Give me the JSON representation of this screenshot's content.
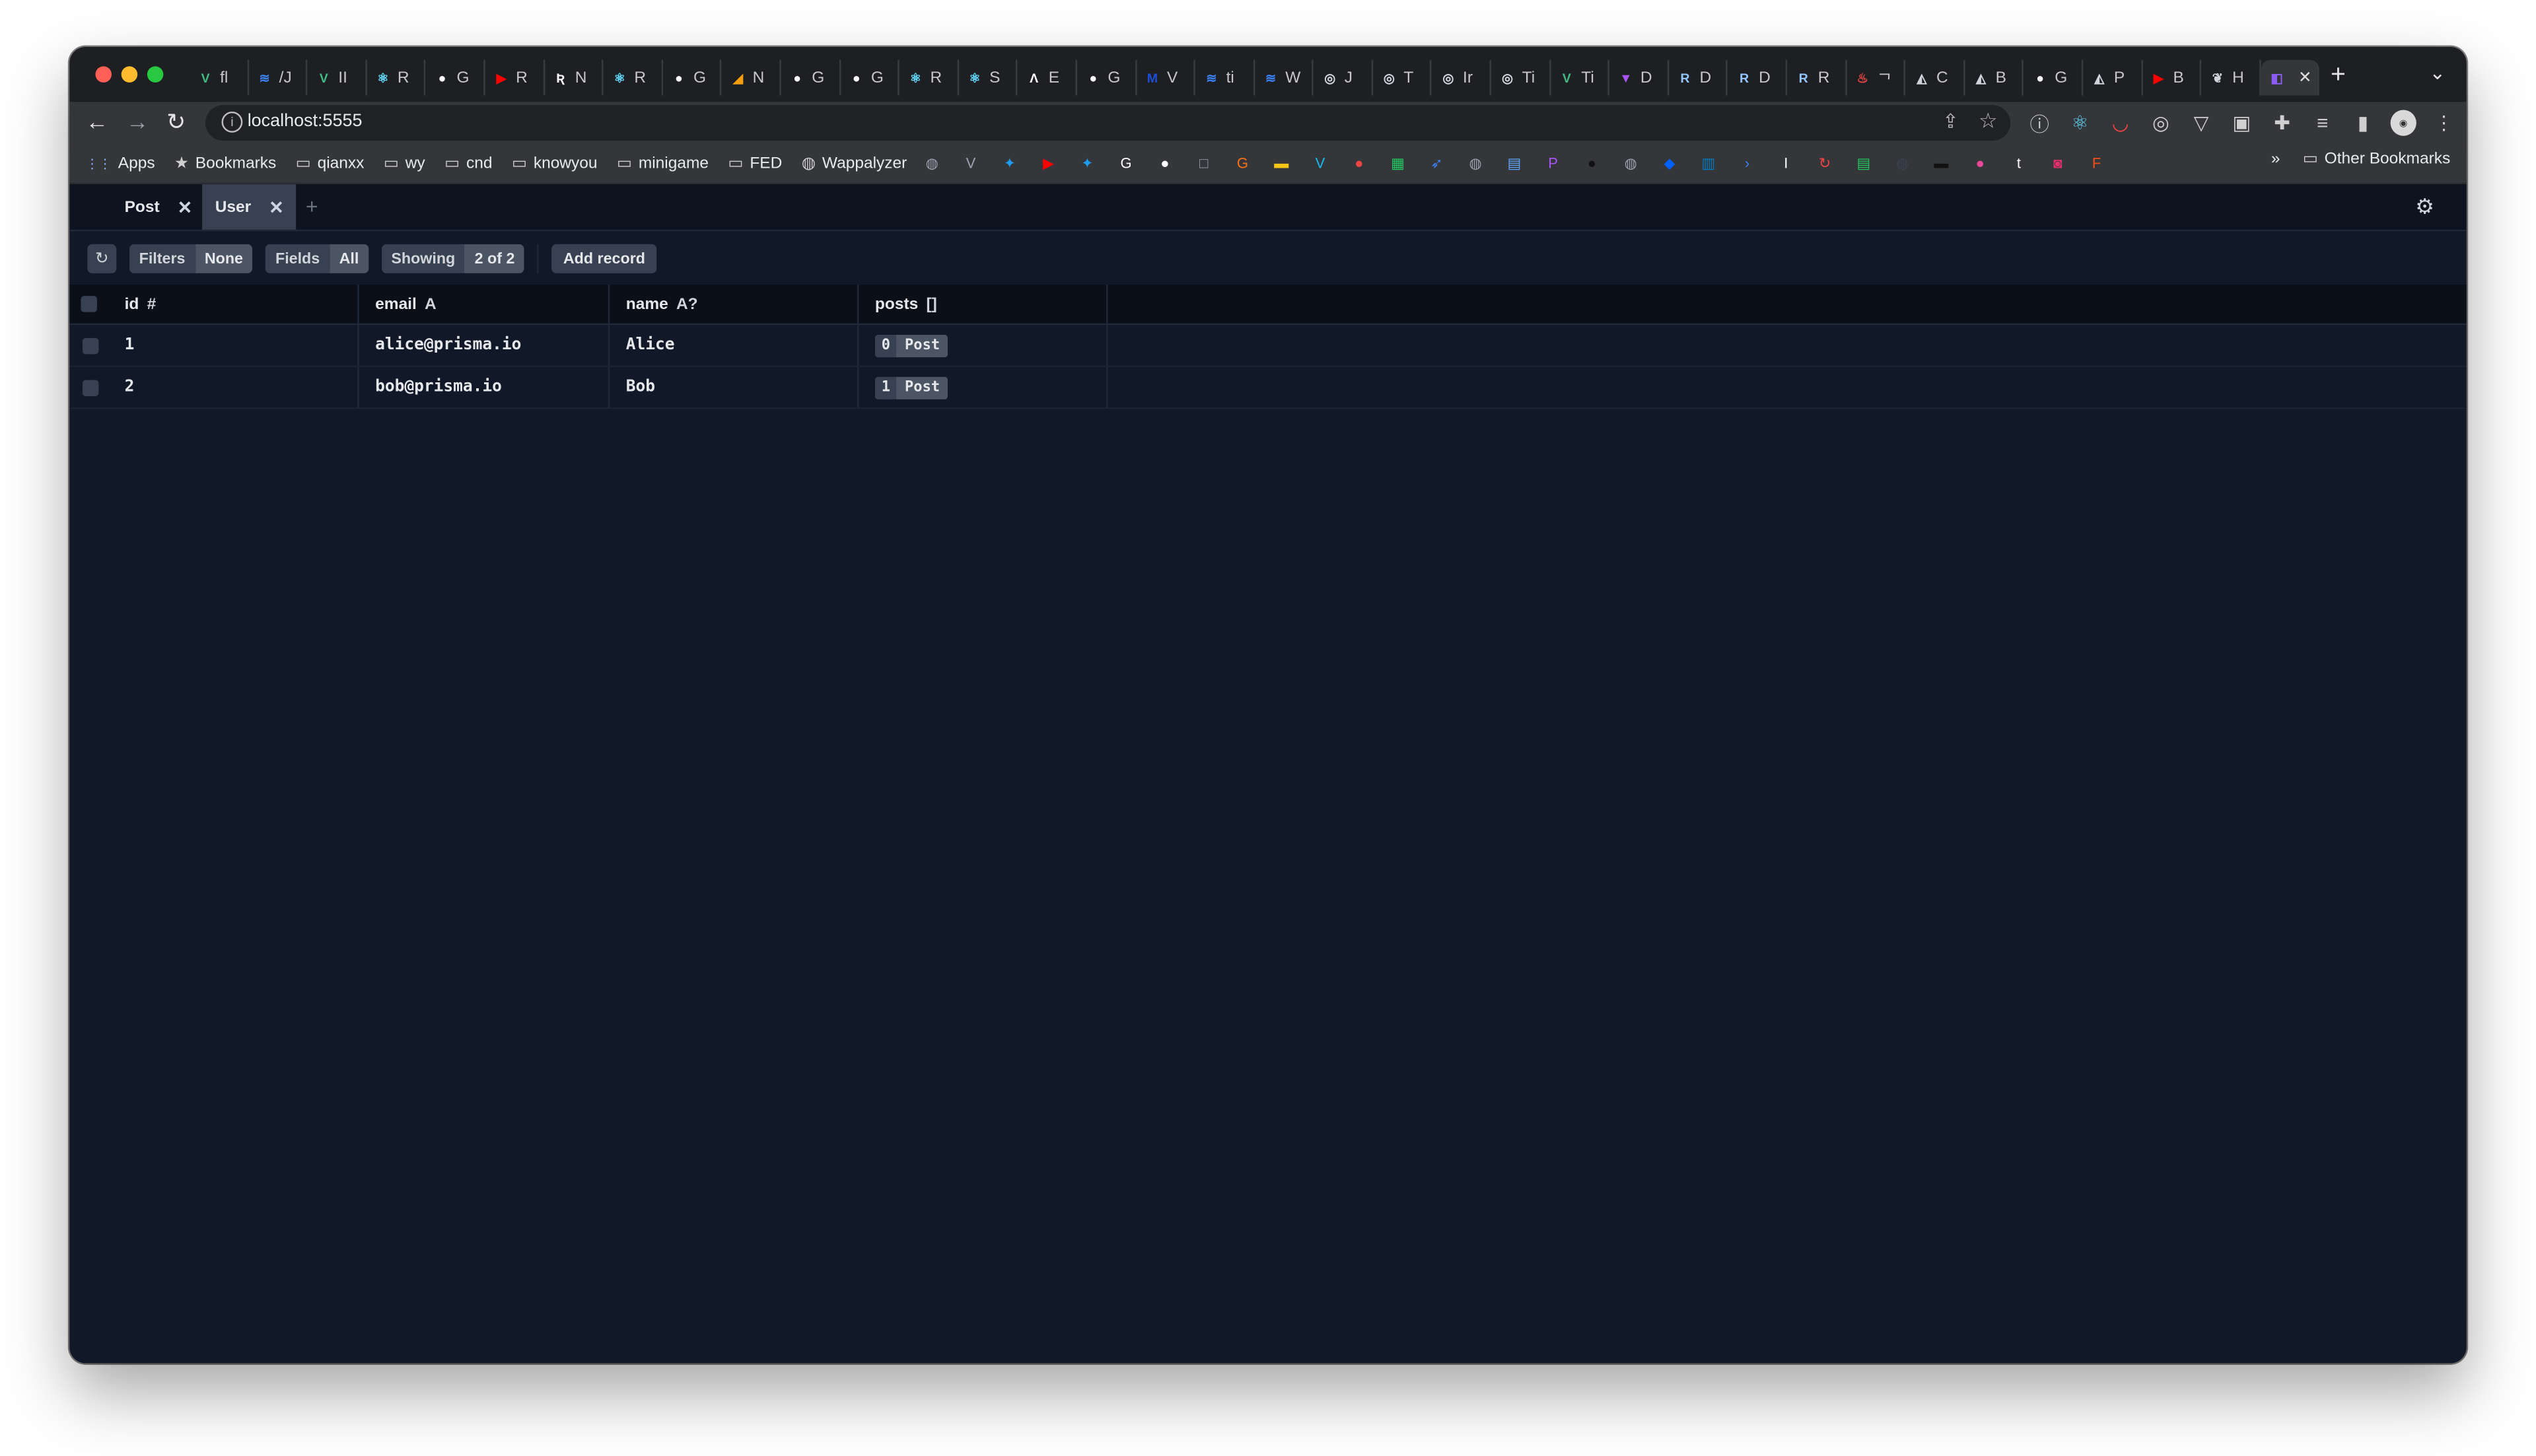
{
  "browser": {
    "tabs": [
      {
        "icon": "vue-icon",
        "color": "#42b883",
        "glyph": "V",
        "label": "fl"
      },
      {
        "icon": "stack-icon",
        "color": "#3b82f6",
        "glyph": "≋",
        "label": "/J"
      },
      {
        "icon": "vue-icon",
        "color": "#42b883",
        "glyph": "V",
        "label": "II"
      },
      {
        "icon": "react-icon",
        "color": "#61dafb",
        "glyph": "⚛",
        "label": "R"
      },
      {
        "icon": "github-icon",
        "color": "#ffffff",
        "glyph": "●",
        "label": "G"
      },
      {
        "icon": "youtube-icon",
        "color": "#ff0000",
        "glyph": "▶",
        "label": "R"
      },
      {
        "icon": "r-icon",
        "color": "#ffffff",
        "glyph": "Ʀ",
        "label": "N"
      },
      {
        "icon": "react-icon",
        "color": "#61dafb",
        "glyph": "⚛",
        "label": "R"
      },
      {
        "icon": "github-icon",
        "color": "#ffffff",
        "glyph": "●",
        "label": "G"
      },
      {
        "icon": "pizza-icon",
        "color": "#f59e0b",
        "glyph": "◢",
        "label": "N"
      },
      {
        "icon": "github-icon",
        "color": "#ffffff",
        "glyph": "●",
        "label": "G"
      },
      {
        "icon": "github-icon",
        "color": "#ffffff",
        "glyph": "●",
        "label": "G"
      },
      {
        "icon": "react-icon",
        "color": "#61dafb",
        "glyph": "⚛",
        "label": "R"
      },
      {
        "icon": "react-icon",
        "color": "#61dafb",
        "glyph": "⚛",
        "label": "S"
      },
      {
        "icon": "caret-icon",
        "color": "#ffffff",
        "glyph": "Λ",
        "label": "E"
      },
      {
        "icon": "github-icon",
        "color": "#ffffff",
        "glyph": "●",
        "label": "G"
      },
      {
        "icon": "m-icon",
        "color": "#1d4ed8",
        "glyph": "M",
        "label": "V"
      },
      {
        "icon": "stack-icon",
        "color": "#3b82f6",
        "glyph": "≋",
        "label": "ti"
      },
      {
        "icon": "stack-icon",
        "color": "#3b82f6",
        "glyph": "≋",
        "label": "W"
      },
      {
        "icon": "openai-icon",
        "color": "#d1d5db",
        "glyph": "◎",
        "label": "J"
      },
      {
        "icon": "openai-icon",
        "color": "#d1d5db",
        "glyph": "◎",
        "label": "T"
      },
      {
        "icon": "openai-icon",
        "color": "#d1d5db",
        "glyph": "◎",
        "label": "Ir"
      },
      {
        "icon": "openai-icon",
        "color": "#d1d5db",
        "glyph": "◎",
        "label": "Ti"
      },
      {
        "icon": "vue-icon",
        "color": "#42b883",
        "glyph": "V",
        "label": "Ti"
      },
      {
        "icon": "vite-icon",
        "color": "#a855f7",
        "glyph": "▼",
        "label": "D"
      },
      {
        "icon": "r-icon",
        "color": "#93c5fd",
        "glyph": "R",
        "label": "D"
      },
      {
        "icon": "r-icon",
        "color": "#93c5fd",
        "glyph": "R",
        "label": "D"
      },
      {
        "icon": "r-icon",
        "color": "#93c5fd",
        "glyph": "R",
        "label": "R"
      },
      {
        "icon": "fire-icon",
        "color": "#ef4444",
        "glyph": "♨",
        "label": "ᄀ"
      },
      {
        "icon": "prisma-icon",
        "color": "#d1d5db",
        "glyph": "◭",
        "label": "C"
      },
      {
        "icon": "prisma-icon",
        "color": "#d1d5db",
        "glyph": "◭",
        "label": "B"
      },
      {
        "icon": "github-icon",
        "color": "#ffffff",
        "glyph": "●",
        "label": "G"
      },
      {
        "icon": "prisma-icon",
        "color": "#d1d5db",
        "glyph": "◭",
        "label": "P"
      },
      {
        "icon": "youtube-icon",
        "color": "#ff0000",
        "glyph": "▶",
        "label": "B"
      },
      {
        "icon": "bird-icon",
        "color": "#d1d5db",
        "glyph": "❦",
        "label": "H"
      },
      {
        "icon": "studio-icon",
        "color": "#8b5cf6",
        "glyph": "◧",
        "label": ""
      }
    ],
    "active_tab_index": 35,
    "new_tab_label": "+",
    "tab_search_label": "⌄",
    "address": "localhost:5555",
    "bookmarks": [
      {
        "icon": "apps-icon",
        "label": "Apps"
      },
      {
        "icon": "star-icon",
        "label": "Bookmarks"
      },
      {
        "icon": "folder-icon",
        "label": "qianxx"
      },
      {
        "icon": "folder-icon",
        "label": "wy"
      },
      {
        "icon": "folder-icon",
        "label": "cnd"
      },
      {
        "icon": "folder-icon",
        "label": "knowyou"
      },
      {
        "icon": "folder-icon",
        "label": "minigame"
      },
      {
        "icon": "folder-icon",
        "label": "FED"
      },
      {
        "icon": "globe-icon",
        "label": "Wappalyzer"
      }
    ],
    "bookmark_icons": [
      {
        "name": "globe-icon",
        "color": "#9ca3af",
        "glyph": "◍"
      },
      {
        "name": "v-icon",
        "color": "#9ca3af",
        "glyph": "V"
      },
      {
        "name": "twitter-icon",
        "color": "#1d9bf0",
        "glyph": "✦"
      },
      {
        "name": "youtube-icon",
        "color": "#ff0000",
        "glyph": "▶"
      },
      {
        "name": "twitter-icon",
        "color": "#1d9bf0",
        "glyph": "✦"
      },
      {
        "name": "google-icon",
        "color": "#ffffff",
        "glyph": "G"
      },
      {
        "name": "github-icon",
        "color": "#ffffff",
        "glyph": "●"
      },
      {
        "name": "square-icon",
        "color": "#9ca3af",
        "glyph": "□"
      },
      {
        "name": "g-icon",
        "color": "#f97316",
        "glyph": "G"
      },
      {
        "name": "imdb-icon",
        "color": "#f5c518",
        "glyph": "▬"
      },
      {
        "name": "vimeo-icon",
        "color": "#1ab7ea",
        "glyph": "V"
      },
      {
        "name": "tomato-icon",
        "color": "#ef4444",
        "glyph": "●"
      },
      {
        "name": "calendar-icon",
        "color": "#22c55e",
        "glyph": "▦"
      },
      {
        "name": "arrow-icon",
        "color": "#3b82f6",
        "glyph": "➶"
      },
      {
        "name": "globe-icon",
        "color": "#9ca3af",
        "glyph": "◍"
      },
      {
        "name": "calendar-icon",
        "color": "#60a5fa",
        "glyph": "▤"
      },
      {
        "name": "pin-icon",
        "color": "#a855f7",
        "glyph": "P"
      },
      {
        "name": "dark-circle-icon",
        "color": "#111111",
        "glyph": "●"
      },
      {
        "name": "globe-icon",
        "color": "#9ca3af",
        "glyph": "◍"
      },
      {
        "name": "dropbox-icon",
        "color": "#0061ff",
        "glyph": "◆"
      },
      {
        "name": "trello-icon",
        "color": "#0079bf",
        "glyph": "▥"
      },
      {
        "name": "terminal-icon",
        "color": "#3b82f6",
        "glyph": "›"
      },
      {
        "name": "info-icon",
        "color": "#ffffff",
        "glyph": "I"
      },
      {
        "name": "refresh-icon",
        "color": "#ef4444",
        "glyph": "↻"
      },
      {
        "name": "chart-icon",
        "color": "#22c55e",
        "glyph": "▤"
      },
      {
        "name": "dark-globe-icon",
        "color": "#374151",
        "glyph": "◍"
      },
      {
        "name": "dark-rect-icon",
        "color": "#111111",
        "glyph": "▬"
      },
      {
        "name": "pink-circle-icon",
        "color": "#ec4899",
        "glyph": "●"
      },
      {
        "name": "tumblr-icon",
        "color": "#ffffff",
        "glyph": "t"
      },
      {
        "name": "instagram-icon",
        "color": "#e1306c",
        "glyph": "◙"
      },
      {
        "name": "figma-icon",
        "color": "#f24e1e",
        "glyph": "F"
      }
    ],
    "more_label": "»",
    "other_bookmarks_label": "Other Bookmarks"
  },
  "studio": {
    "tabs": [
      {
        "label": "Post",
        "active": false
      },
      {
        "label": "User",
        "active": true
      }
    ],
    "add_tab_label": "+",
    "toolbar": {
      "filters_label": "Filters",
      "filters_value": "None",
      "fields_label": "Fields",
      "fields_value": "All",
      "showing_label": "Showing",
      "showing_value": "2 of 2",
      "add_record_label": "Add record"
    },
    "columns": [
      {
        "name": "id",
        "type": "#"
      },
      {
        "name": "email",
        "type": "A"
      },
      {
        "name": "name",
        "type": "A?"
      },
      {
        "name": "posts",
        "type": "[]"
      }
    ],
    "rows": [
      {
        "id": "1",
        "email": "alice@prisma.io",
        "name": "Alice",
        "posts_count": "0",
        "posts_label": "Post"
      },
      {
        "id": "2",
        "email": "bob@prisma.io",
        "name": "Bob",
        "posts_count": "1",
        "posts_label": "Post"
      }
    ]
  }
}
